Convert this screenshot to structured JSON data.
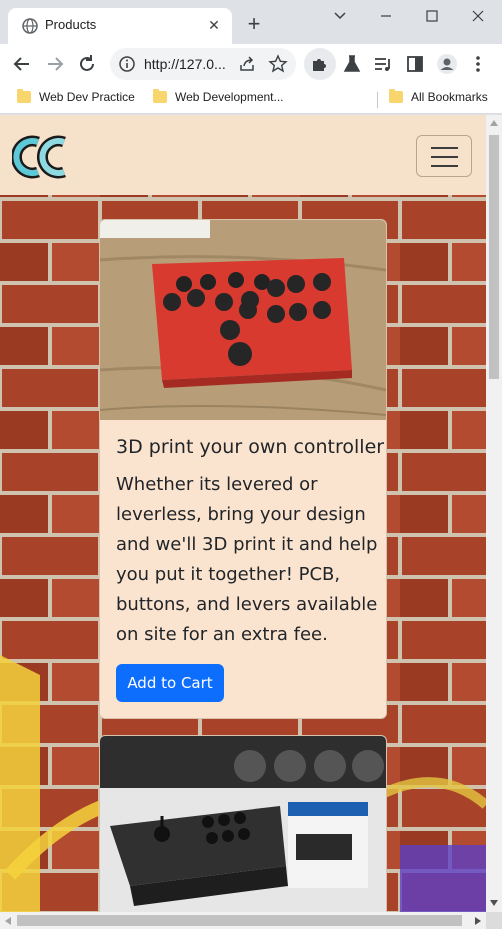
{
  "browser": {
    "tab_title": "Products",
    "url": "http://127.0...",
    "bookmarks": [
      {
        "label": "Web Dev Practice"
      },
      {
        "label": "Web Development..."
      },
      {
        "label": "All Bookmarks"
      }
    ]
  },
  "site": {
    "logo_text": "CC",
    "products": [
      {
        "title": "3D print your own controller",
        "description": "Whether its levered or leverless, bring your design and we'll 3D print it and help you put it together! PCB, buttons, and levers available on site for an extra fee.",
        "button_label": "Add to Cart"
      },
      {
        "title": "",
        "description": "",
        "button_label": ""
      }
    ],
    "colors": {
      "nav_bg": "#f6e1cb",
      "card_bg": "#fbe4cf",
      "button": "#0d6efd",
      "brick": "#9c3a22"
    }
  }
}
